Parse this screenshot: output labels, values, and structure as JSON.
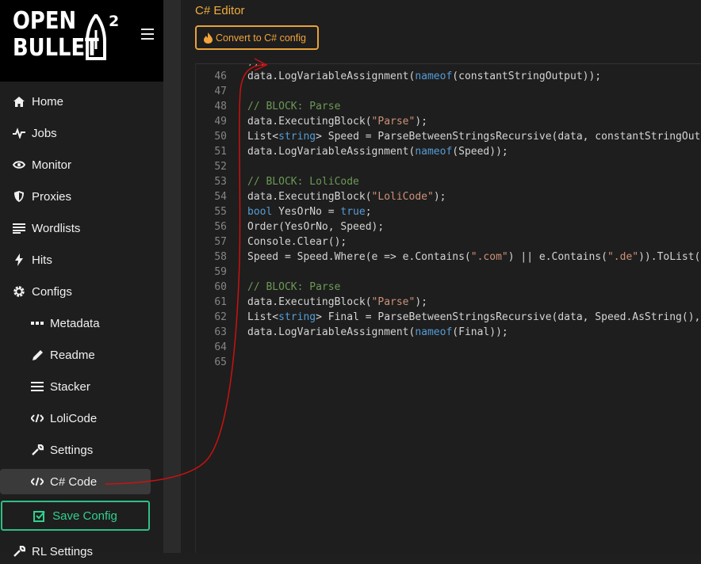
{
  "brand": {
    "line1": "OPEN",
    "line2": "BULLET",
    "superscript": "2"
  },
  "nav": {
    "home": "Home",
    "jobs": "Jobs",
    "monitor": "Monitor",
    "proxies": "Proxies",
    "wordlists": "Wordlists",
    "hits": "Hits",
    "configs": "Configs",
    "metadata": "Metadata",
    "readme": "Readme",
    "stacker": "Stacker",
    "lolicode": "LoliCode",
    "settings": "Settings",
    "csharp": "C# Code",
    "rl_settings": "RL Settings"
  },
  "save_button": "Save Config",
  "header": {
    "title": "C# Editor",
    "convert_button": "Convert to C# config"
  },
  "colors": {
    "accent_orange": "#f0ad3c",
    "save_green": "#2fd18f",
    "annotation_red": "#cc1111"
  },
  "editor": {
    "lines": [
      {
        "n": "",
        "tokens": [
          [
            "",
            "));"
          ]
        ]
      },
      {
        "n": "46",
        "tokens": [
          [
            "",
            "data.LogVariableAssignment("
          ],
          [
            "kw",
            "nameof"
          ],
          [
            "",
            "(constantStringOutput));"
          ]
        ]
      },
      {
        "n": "47",
        "tokens": []
      },
      {
        "n": "48",
        "tokens": [
          [
            "cmt",
            "// BLOCK: Parse"
          ]
        ]
      },
      {
        "n": "49",
        "tokens": [
          [
            "",
            "data.ExecutingBlock("
          ],
          [
            "str",
            "\"Parse\""
          ],
          [
            "",
            ");"
          ]
        ]
      },
      {
        "n": "50",
        "tokens": [
          [
            "",
            "List<"
          ],
          [
            "kw",
            "string"
          ],
          [
            "",
            "> Speed = ParseBetweenStringsRecursive(data, constantStringOutput,"
          ]
        ]
      },
      {
        "n": "51",
        "tokens": [
          [
            "",
            "data.LogVariableAssignment("
          ],
          [
            "kw",
            "nameof"
          ],
          [
            "",
            "(Speed));"
          ]
        ]
      },
      {
        "n": "52",
        "tokens": []
      },
      {
        "n": "53",
        "tokens": [
          [
            "cmt",
            "// BLOCK: LoliCode"
          ]
        ]
      },
      {
        "n": "54",
        "tokens": [
          [
            "",
            "data.ExecutingBlock("
          ],
          [
            "str",
            "\"LoliCode\""
          ],
          [
            "",
            ");"
          ]
        ]
      },
      {
        "n": "55",
        "tokens": [
          [
            "kw",
            "bool"
          ],
          [
            "",
            " YesOrNo = "
          ],
          [
            "kw",
            "true"
          ],
          [
            "",
            ";"
          ]
        ]
      },
      {
        "n": "56",
        "tokens": [
          [
            "",
            "Order(YesOrNo, Speed);"
          ]
        ]
      },
      {
        "n": "57",
        "tokens": [
          [
            "",
            "Console.Clear();"
          ]
        ]
      },
      {
        "n": "58",
        "tokens": [
          [
            "",
            "Speed = Speed.Where(e => e.Contains("
          ],
          [
            "str",
            "\".com\""
          ],
          [
            "",
            ") || e.Contains("
          ],
          [
            "str",
            "\".de\""
          ],
          [
            "",
            ")).ToList();"
          ]
        ]
      },
      {
        "n": "59",
        "tokens": []
      },
      {
        "n": "60",
        "tokens": [
          [
            "cmt",
            "// BLOCK: Parse"
          ]
        ]
      },
      {
        "n": "61",
        "tokens": [
          [
            "",
            "data.ExecutingBlock("
          ],
          [
            "str",
            "\"Parse\""
          ],
          [
            "",
            ");"
          ]
        ]
      },
      {
        "n": "62",
        "tokens": [
          [
            "",
            "List<"
          ],
          [
            "kw",
            "string"
          ],
          [
            "",
            "> Final = ParseBetweenStringsRecursive(data, Speed.AsString(),"
          ]
        ]
      },
      {
        "n": "63",
        "tokens": [
          [
            "",
            "data.LogVariableAssignment("
          ],
          [
            "kw",
            "nameof"
          ],
          [
            "",
            "(Final));"
          ]
        ]
      },
      {
        "n": "64",
        "tokens": []
      },
      {
        "n": "65",
        "tokens": []
      }
    ]
  }
}
